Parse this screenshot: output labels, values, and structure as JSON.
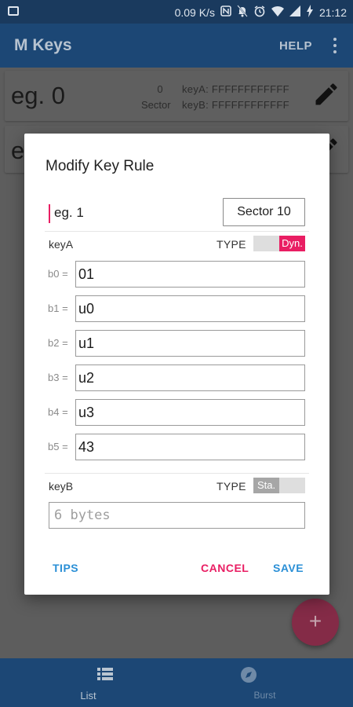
{
  "status_bar": {
    "net_speed": "0.09 K/s",
    "time": "21:12"
  },
  "app_bar": {
    "title": "M Keys",
    "help_label": "HELP"
  },
  "list": {
    "cards": [
      {
        "name": "eg. 0",
        "sector_num": "0",
        "sector_label": "Sector",
        "keyA": "keyA: FFFFFFFFFFFF",
        "keyB": "keyB: FFFFFFFFFFFF"
      },
      {
        "name": "e"
      }
    ]
  },
  "dialog": {
    "title": "Modify Key Rule",
    "name_value": "eg. 1",
    "sector_button": "Sector 10",
    "keyA": {
      "label": "keyA",
      "type_label": "TYPE",
      "type_value": "Dyn.",
      "bytes": [
        {
          "label": "b0 =",
          "value": "01"
        },
        {
          "label": "b1 =",
          "value": "u0"
        },
        {
          "label": "b2 =",
          "value": "u1"
        },
        {
          "label": "b3 =",
          "value": "u2"
        },
        {
          "label": "b4 =",
          "value": "u3"
        },
        {
          "label": "b5 =",
          "value": "43"
        }
      ]
    },
    "keyB": {
      "label": "keyB",
      "type_label": "TYPE",
      "type_value": "Sta.",
      "placeholder": "6 bytes"
    },
    "buttons": {
      "tips": "TIPS",
      "cancel": "CANCEL",
      "save": "SAVE"
    }
  },
  "fab": {
    "icon": "plus-icon"
  },
  "bottom_nav": {
    "items": [
      {
        "label": "List",
        "icon": "list-icon"
      },
      {
        "label": "Burst",
        "icon": "compass-icon"
      }
    ]
  },
  "colors": {
    "primary": "#1c4775",
    "accent": "#e91e63",
    "link": "#2a8fd6"
  }
}
